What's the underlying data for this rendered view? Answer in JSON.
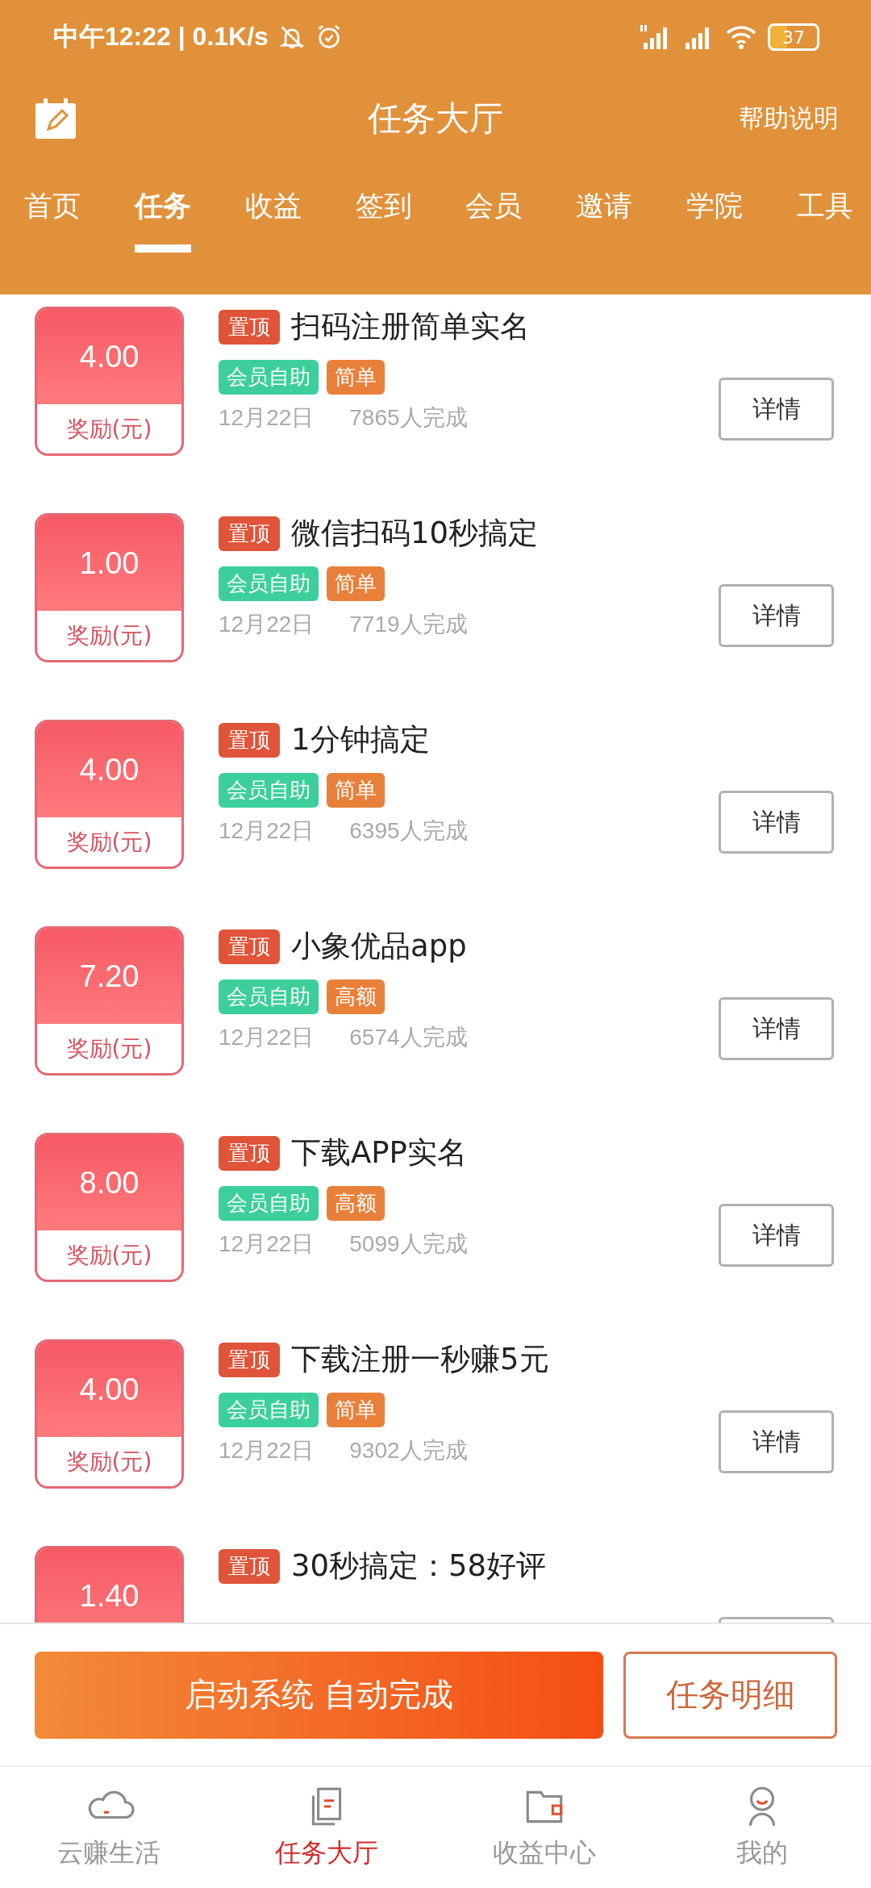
{
  "status_bar": {
    "time": "中午12:22 | 0.1K/s",
    "battery": "37"
  },
  "header": {
    "title": "任务大厅",
    "help": "帮助说明"
  },
  "tabs": [
    {
      "label": "首页",
      "selected": false
    },
    {
      "label": "任务",
      "selected": true
    },
    {
      "label": "收益",
      "selected": false
    },
    {
      "label": "签到",
      "selected": false
    },
    {
      "label": "会员",
      "selected": false
    },
    {
      "label": "邀请",
      "selected": false
    },
    {
      "label": "学院",
      "selected": false
    },
    {
      "label": "工具",
      "selected": false
    }
  ],
  "tasks": [
    {
      "amount": "4.00",
      "reward_label": "奖励(元)",
      "pin": "置顶",
      "title": "扫码注册简单实名",
      "tags": [
        {
          "text": "会员自助",
          "color": "#3ccf9c"
        },
        {
          "text": "简单",
          "color": "#e8803a"
        }
      ],
      "date": "12月22日",
      "completed": "7865人完成",
      "button": "详情"
    },
    {
      "amount": "1.00",
      "reward_label": "奖励(元)",
      "pin": "置顶",
      "title": "微信扫码10秒搞定",
      "tags": [
        {
          "text": "会员自助",
          "color": "#3ccf9c"
        },
        {
          "text": "简单",
          "color": "#e8803a"
        }
      ],
      "date": "12月22日",
      "completed": "7719人完成",
      "button": "详情"
    },
    {
      "amount": "4.00",
      "reward_label": "奖励(元)",
      "pin": "置顶",
      "title": "1分钟搞定",
      "tags": [
        {
          "text": "会员自助",
          "color": "#3ccf9c"
        },
        {
          "text": "简单",
          "color": "#e8803a"
        }
      ],
      "date": "12月22日",
      "completed": "6395人完成",
      "button": "详情"
    },
    {
      "amount": "7.20",
      "reward_label": "奖励(元)",
      "pin": "置顶",
      "title": "小象优品app",
      "tags": [
        {
          "text": "会员自助",
          "color": "#3ccf9c"
        },
        {
          "text": "高额",
          "color": "#e8803a"
        }
      ],
      "date": "12月22日",
      "completed": "6574人完成",
      "button": "详情"
    },
    {
      "amount": "8.00",
      "reward_label": "奖励(元)",
      "pin": "置顶",
      "title": "下载APP实名",
      "tags": [
        {
          "text": "会员自助",
          "color": "#3ccf9c"
        },
        {
          "text": "高额",
          "color": "#e8803a"
        }
      ],
      "date": "12月22日",
      "completed": "5099人完成",
      "button": "详情"
    },
    {
      "amount": "4.00",
      "reward_label": "奖励(元)",
      "pin": "置顶",
      "title": "下载注册一秒赚5元",
      "tags": [
        {
          "text": "会员自助",
          "color": "#3ccf9c"
        },
        {
          "text": "简单",
          "color": "#e8803a"
        }
      ],
      "date": "12月22日",
      "completed": "9302人完成",
      "button": "详情"
    },
    {
      "amount": "1.40",
      "pin": "置顶",
      "title": "30秒搞定：58好评"
    }
  ],
  "actions": {
    "primary": "启动系统 自动完成",
    "secondary": "任务明细"
  },
  "bottom_nav": [
    {
      "label": "云赚生活",
      "selected": false
    },
    {
      "label": "任务大厅",
      "selected": true
    },
    {
      "label": "收益中心",
      "selected": false
    },
    {
      "label": "我的",
      "selected": false
    }
  ]
}
